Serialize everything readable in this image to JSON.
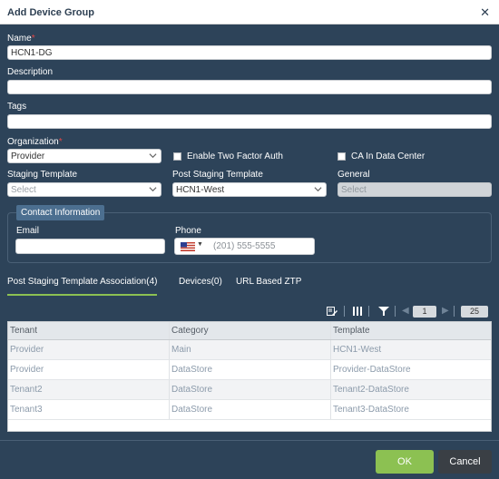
{
  "dialog": {
    "title": "Add Device Group",
    "close_icon": "close-icon"
  },
  "form": {
    "name_label": "Name",
    "required_mark": "*",
    "name_value": "HCN1-DG",
    "description_label": "Description",
    "description_value": "",
    "tags_label": "Tags",
    "tags_value": "",
    "organization_label": "Organization",
    "organization_value": "Provider",
    "two_factor_label": "Enable Two Factor Auth",
    "ca_label": "CA In Data Center",
    "staging_template_label": "Staging Template",
    "staging_template_placeholder": "Select",
    "post_staging_label": "Post Staging Template",
    "post_staging_value": "HCN1-West",
    "general_label": "General",
    "general_placeholder": "Select"
  },
  "contact": {
    "legend": "Contact Information",
    "email_label": "Email",
    "email_value": "",
    "phone_label": "Phone",
    "phone_placeholder": "(201) 555-5555",
    "flag_icon": "us-flag-icon"
  },
  "tabs": [
    {
      "label": "Post Staging Template Association(4)",
      "active": true
    },
    {
      "label": "Devices(0)",
      "active": false
    },
    {
      "label": "URL Based ZTP",
      "active": false
    }
  ],
  "toolbar": {
    "edit_icon": "edit-icon",
    "columns_icon": "columns-icon",
    "filter_icon": "filter-icon",
    "prev_icon": "chevron-left-icon",
    "next_icon": "chevron-right-icon",
    "page": "1",
    "page_size": "25"
  },
  "table": {
    "headers": [
      "Tenant",
      "Category",
      "Template"
    ],
    "rows": [
      [
        "Provider",
        "Main",
        "HCN1-West"
      ],
      [
        "Provider",
        "DataStore",
        "Provider-DataStore"
      ],
      [
        "Tenant2",
        "DataStore",
        "Tenant2-DataStore"
      ],
      [
        "Tenant3",
        "DataStore",
        "Tenant3-DataStore"
      ]
    ]
  },
  "footer": {
    "ok_label": "OK",
    "cancel_label": "Cancel"
  },
  "colors": {
    "background": "#2d4359",
    "accent": "#8cc152",
    "required": "#e04646"
  }
}
